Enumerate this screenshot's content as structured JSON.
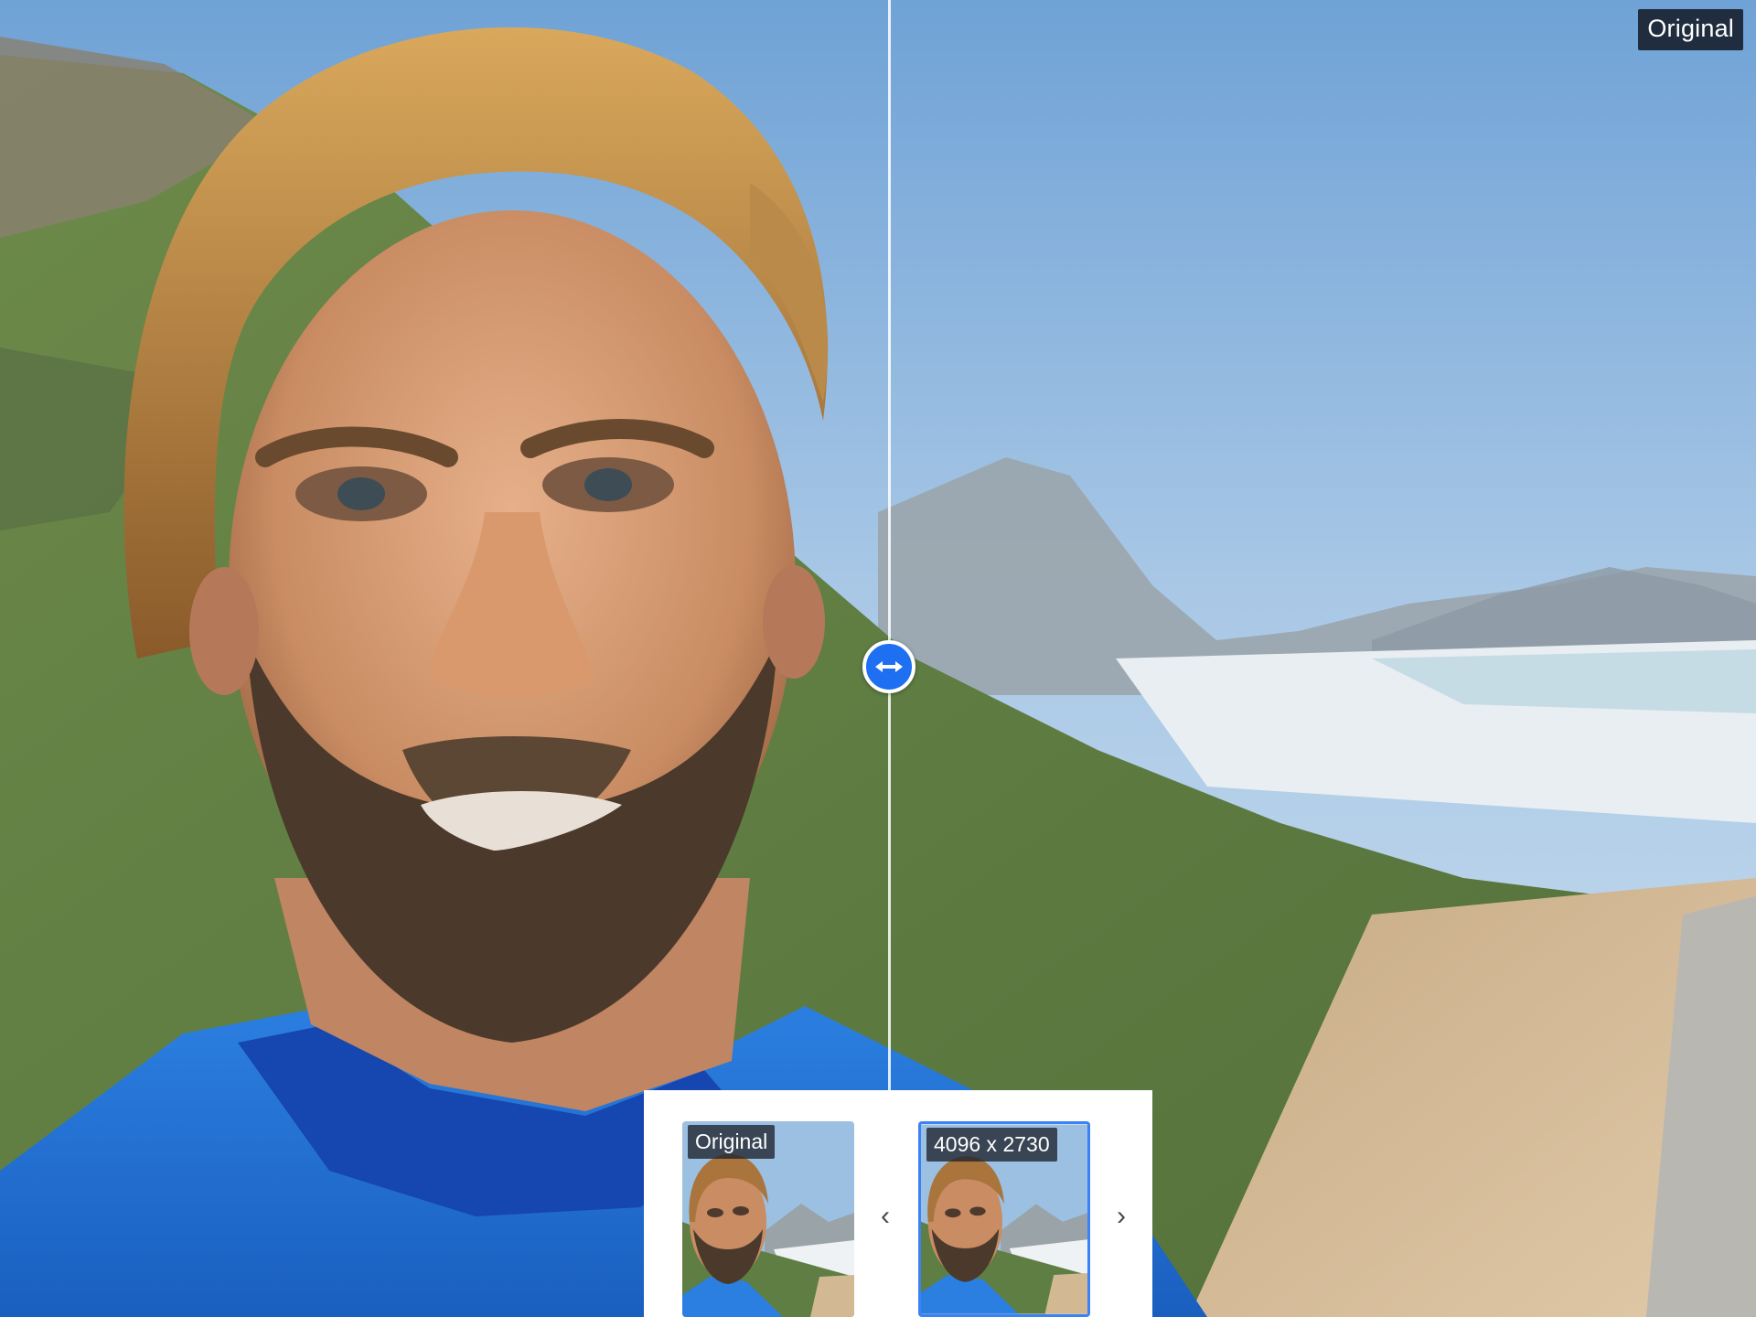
{
  "viewer": {
    "version_label": "Original",
    "handle_icon": "horizontal-arrows-icon"
  },
  "thumbnails": [
    {
      "caption": "Original",
      "selected": false
    },
    {
      "caption": "4096 x 2730",
      "selected": true
    }
  ],
  "nav": {
    "prev_icon": "chevron-left-icon",
    "next_icon": "chevron-right-icon",
    "prev_glyph": "‹",
    "next_glyph": "›"
  },
  "colors": {
    "accent": "#1e6ff2",
    "selected_border": "#3b82f6",
    "label_bg": "#141c2a"
  }
}
